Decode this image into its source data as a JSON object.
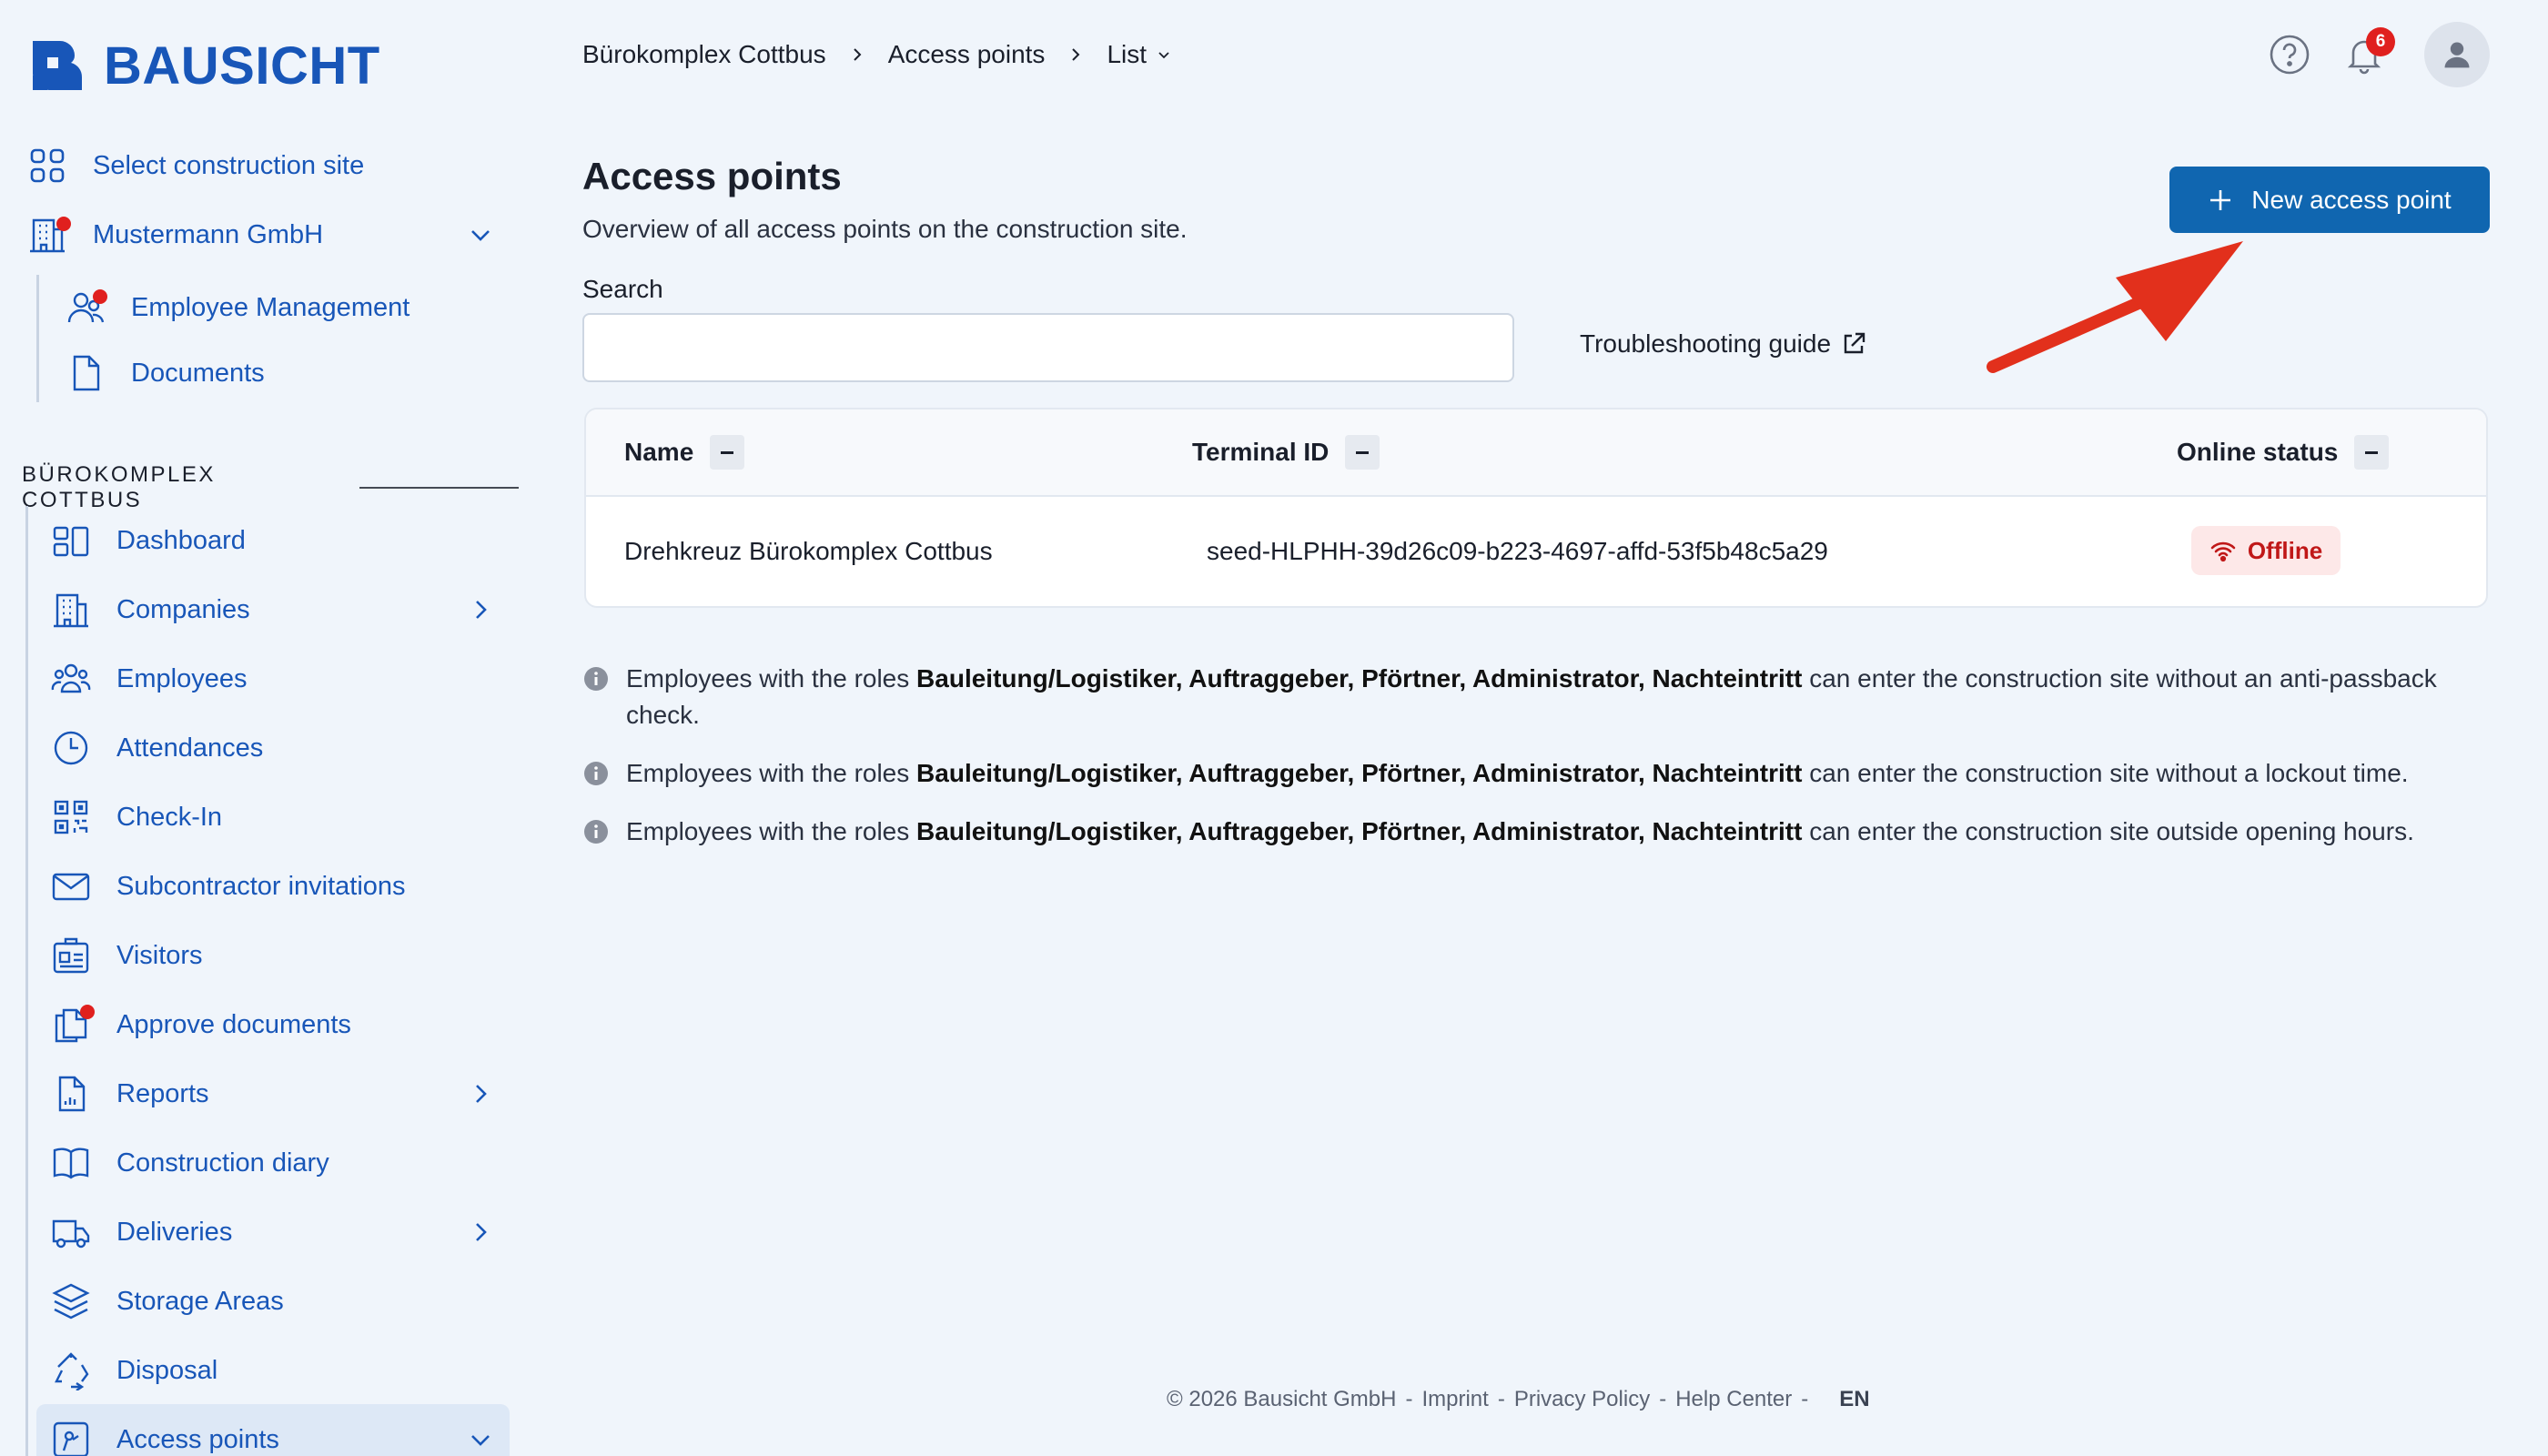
{
  "brand": {
    "name": "BAUSICHT",
    "color": "#1856b8"
  },
  "sidebar": {
    "top_items": [
      {
        "label": "Select construction site",
        "icon": "grid-icon"
      },
      {
        "label": "Mustermann GmbH",
        "icon": "building-icon"
      },
      {
        "label": "Employee Management",
        "icon": "users-icon"
      },
      {
        "label": "Documents",
        "icon": "document-icon"
      }
    ],
    "section_title": "BÜROKOMPLEX COTTBUS",
    "items": [
      {
        "label": "Dashboard",
        "icon": "dashboard-icon"
      },
      {
        "label": "Companies",
        "icon": "building-icon"
      },
      {
        "label": "Employees",
        "icon": "users-icon"
      },
      {
        "label": "Attendances",
        "icon": "clock-icon"
      },
      {
        "label": "Check-In",
        "icon": "qr-code-icon"
      },
      {
        "label": "Subcontractor invitations",
        "icon": "envelope-icon"
      },
      {
        "label": "Visitors",
        "icon": "id-card-icon"
      },
      {
        "label": "Approve documents",
        "icon": "documents-icon"
      },
      {
        "label": "Reports",
        "icon": "report-icon"
      },
      {
        "label": "Construction diary",
        "icon": "book-icon"
      },
      {
        "label": "Deliveries",
        "icon": "truck-icon"
      },
      {
        "label": "Storage Areas",
        "icon": "layers-icon"
      },
      {
        "label": "Disposal",
        "icon": "recycle-icon"
      },
      {
        "label": "Access points",
        "icon": "access-point-icon"
      }
    ]
  },
  "breadcrumb": [
    "Bürokomplex Cottbus",
    "Access points",
    "List"
  ],
  "notifications": {
    "count": "6"
  },
  "main": {
    "title": "Access points",
    "subtitle": "Overview of all access points on the construction site.",
    "new_button_label": "New access point",
    "search_label": "Search",
    "search_value": "",
    "troubleshooting_label": "Troubleshooting guide",
    "table": {
      "headers": [
        "Name",
        "Terminal ID",
        "Online status"
      ],
      "rows": [
        {
          "name": "Drehkreuz Bürokomplex Cottbus",
          "terminal_id": "seed-HLPHH-39d26c09-b223-4697-affd-53f5b48c5a29",
          "status": "Offline"
        }
      ]
    },
    "info": [
      {
        "pre": "Employees with the roles ",
        "roles": "Bauleitung/Logistiker, Auftraggeber, Pförtner, Administrator, Nachteintritt",
        "post": " can enter the construction site without an anti-passback check."
      },
      {
        "pre": "Employees with the roles ",
        "roles": "Bauleitung/Logistiker, Auftraggeber, Pförtner, Administrator, Nachteintritt",
        "post": " can enter the construction site without a lockout time."
      },
      {
        "pre": "Employees with the roles ",
        "roles": "Bauleitung/Logistiker, Auftraggeber, Pförtner, Administrator, Nachteintritt",
        "post": " can enter the construction site outside opening hours."
      }
    ]
  },
  "footer": {
    "copyright": "© 2026 Bausicht GmbH",
    "links": [
      "Imprint",
      "Privacy Policy",
      "Help Center"
    ],
    "language": "EN"
  },
  "colors": {
    "accent": "#1066b0",
    "offline": "#c01818",
    "dot": "#e0201e",
    "annotation_arrow": "#e2301c"
  }
}
